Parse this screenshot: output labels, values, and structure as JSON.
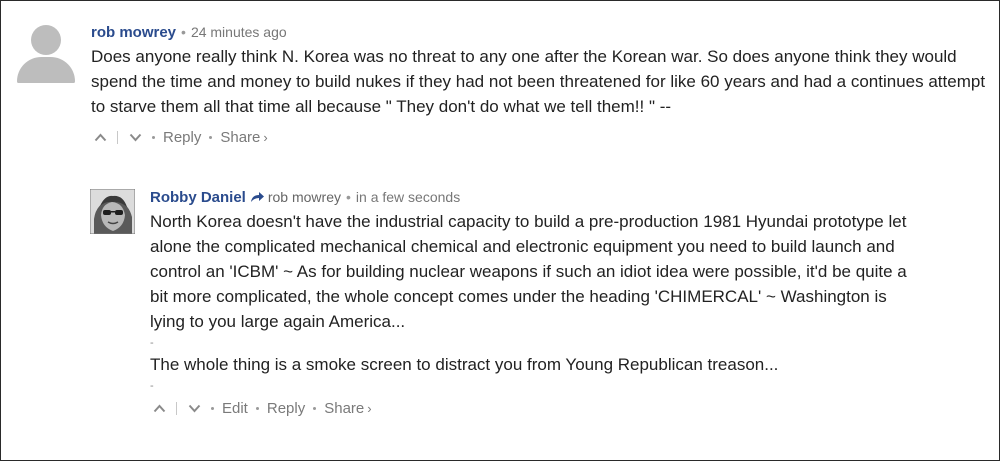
{
  "top_comment": {
    "author": "rob mowrey",
    "timestamp": "24 minutes ago",
    "text": "Does anyone really think N. Korea was no threat to any one after the Korean war. So does anyone think they would spend the time and money to build nukes if they had not been threatened for like 60 years and had a continues attempt to starve them all that time all because \" They don't do what we tell them!! \" --",
    "actions": {
      "reply": "Reply",
      "share": "Share",
      "share_chevron": "›"
    }
  },
  "reply_comment": {
    "author": "Robby Daniel",
    "in_reply_to": "rob mowrey",
    "timestamp": "in a few seconds",
    "paragraph_1": "North Korea doesn't have the industrial capacity to build a pre-production 1981 Hyundai prototype let alone the complicated mechanical chemical and electronic equipment you need to build launch and control an 'ICBM' ~ As for building nuclear weapons if such an idiot idea were possible, it'd be quite a bit more complicated, the whole concept comes under the heading 'CHIMERCAL' ~ Washington is lying to you large again America...",
    "separator_1": "-",
    "paragraph_2": "The whole thing is a smoke screen to distract you from Young Republican treason...",
    "separator_2": "-",
    "actions": {
      "edit": "Edit",
      "reply": "Reply",
      "share": "Share",
      "share_chevron": "›"
    }
  },
  "meta_separator": "•",
  "colors": {
    "author": "#2a4b8d",
    "meta": "#777777",
    "text": "#222222",
    "avatar_placeholder": "#bdbdbd",
    "frame_border": "#2a2a2a"
  },
  "icons": {
    "upvote": "chevron-up-icon",
    "downvote": "chevron-down-icon",
    "reply_arrow": "reply-arrow-icon",
    "default_avatar": "user-silhouette-icon"
  }
}
